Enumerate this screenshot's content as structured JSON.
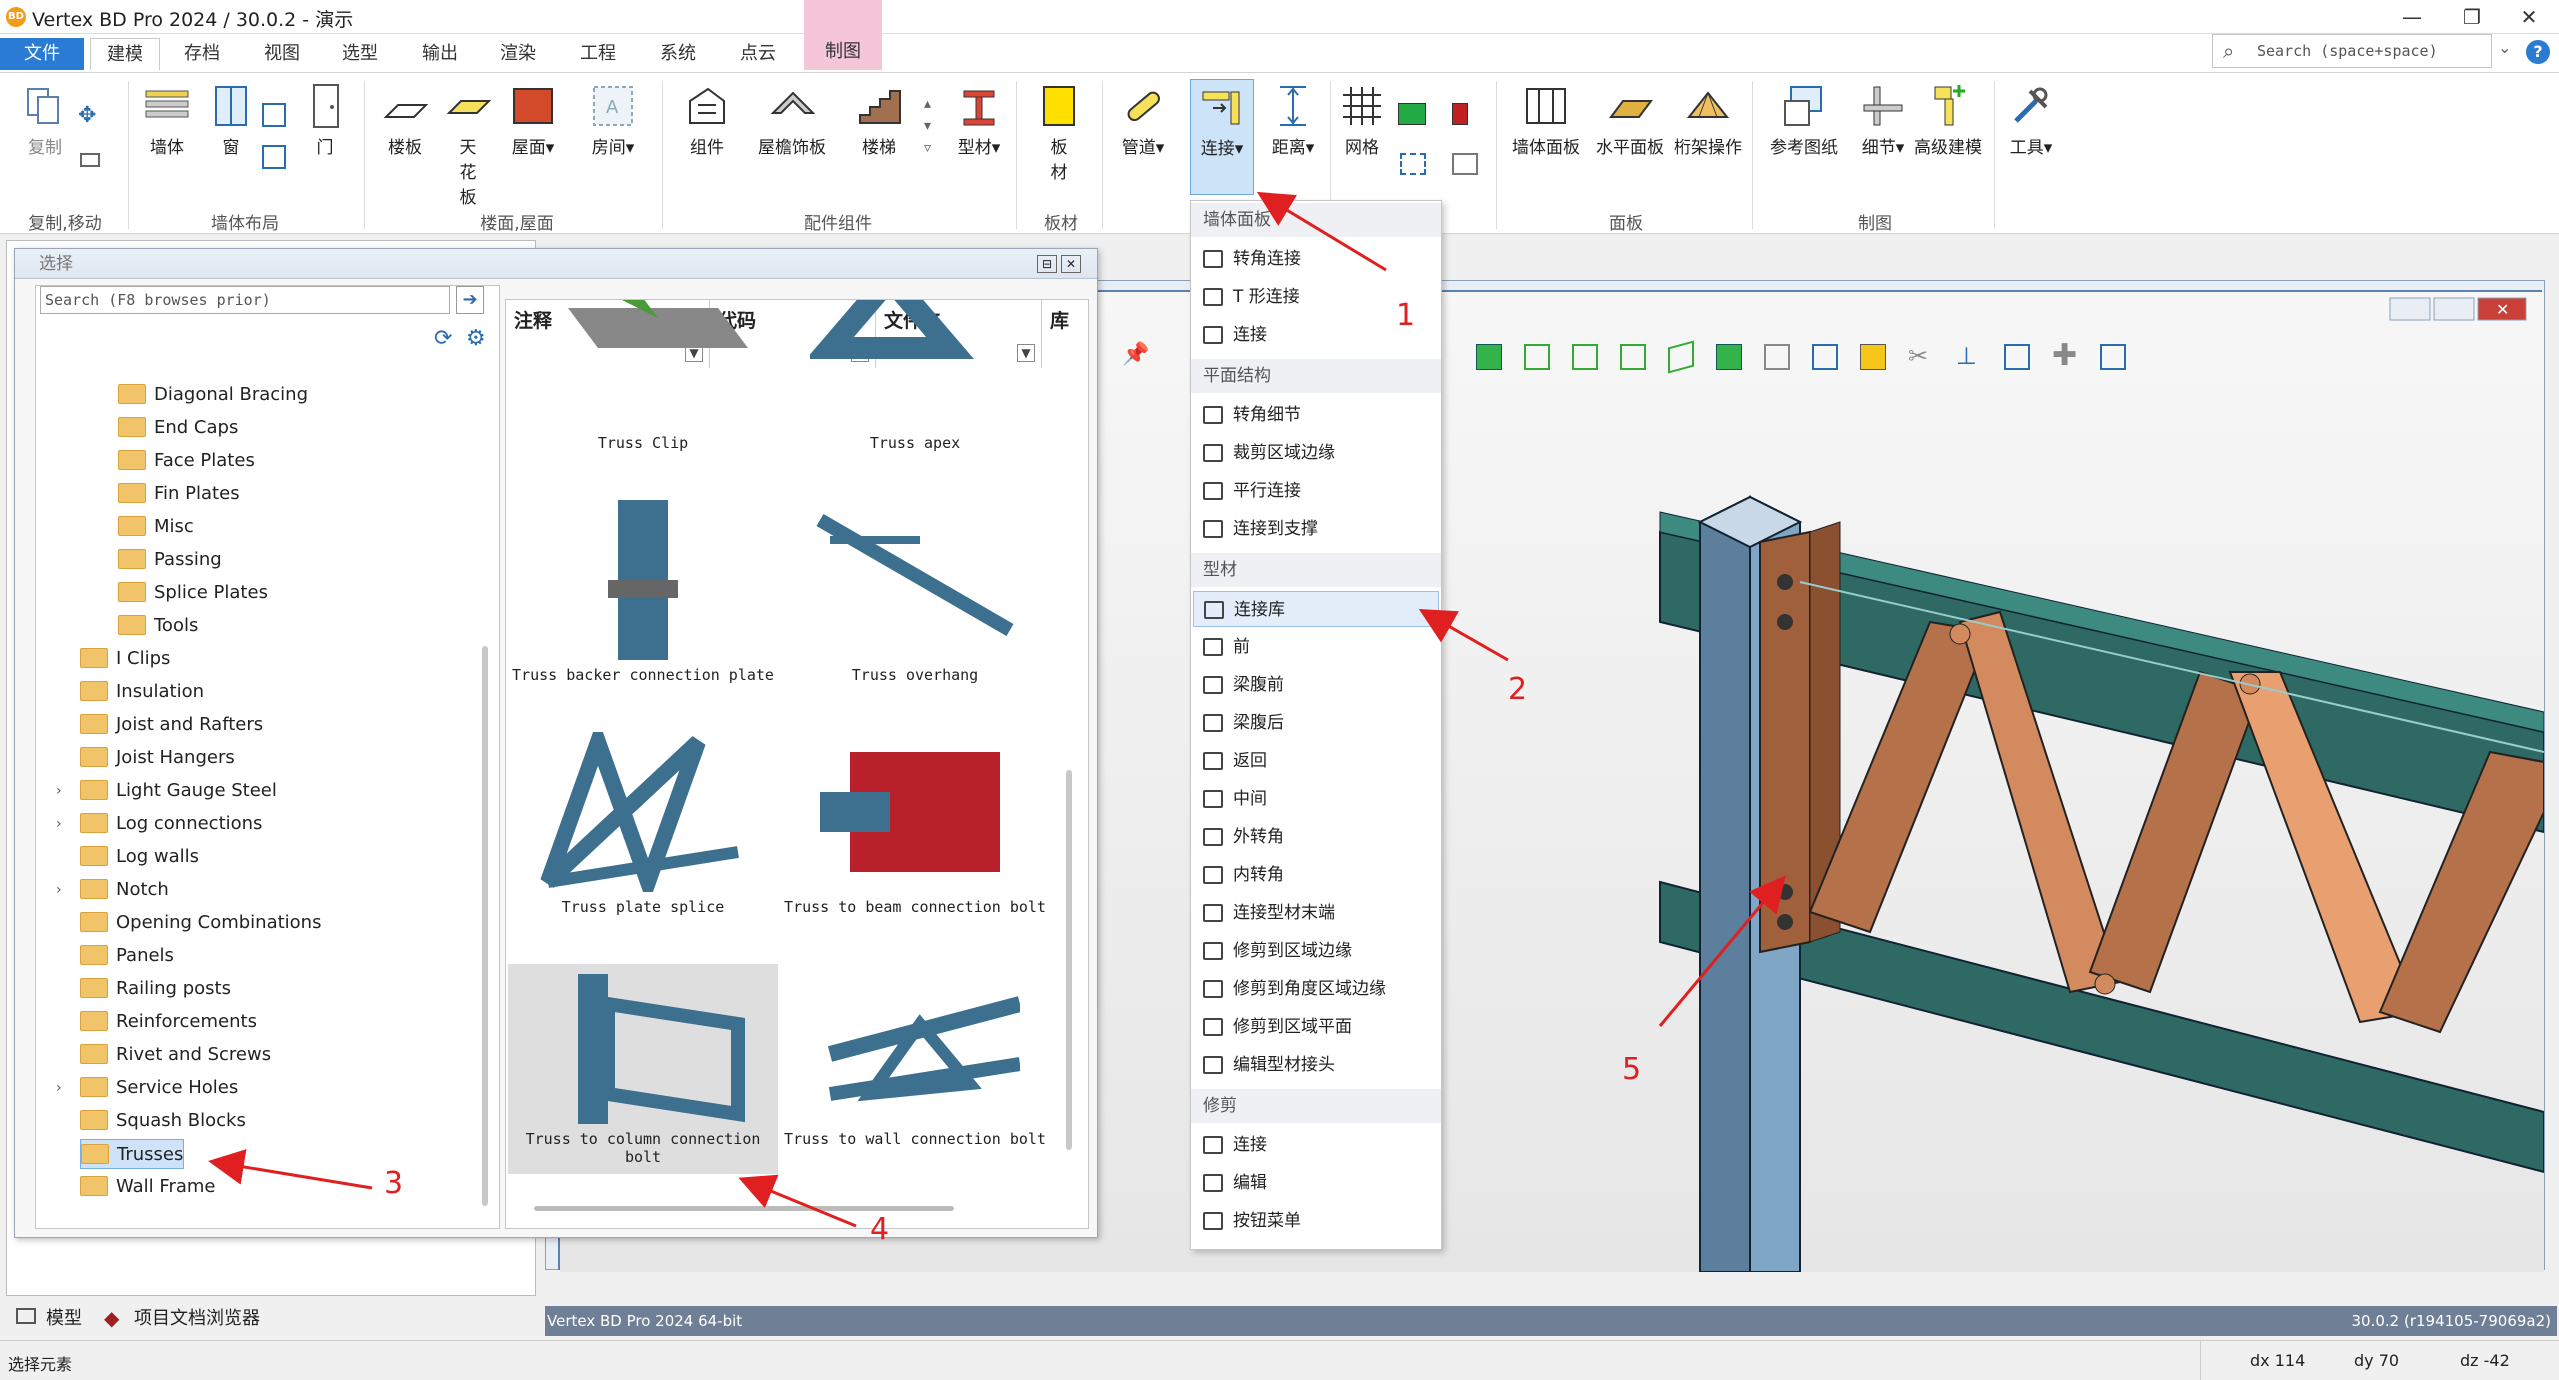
{
  "app": {
    "title": "Vertex BD Pro 2024 / 30.0.2 - 演示",
    "logo": "BD"
  },
  "window_controls": {
    "minimize": "—",
    "maximize": "❐",
    "close": "✕"
  },
  "tabs": [
    {
      "label": "文件"
    },
    {
      "label": "建模"
    },
    {
      "label": "存档"
    },
    {
      "label": "视图"
    },
    {
      "label": "选型"
    },
    {
      "label": "输出"
    },
    {
      "label": "渲染"
    },
    {
      "label": "工程"
    },
    {
      "label": "系统"
    },
    {
      "label": "点云"
    },
    {
      "label": "制图"
    }
  ],
  "search": {
    "placeholder": "Search (space+space)"
  },
  "ribbon": {
    "buttons": {
      "copy": "复制",
      "wall": "墙体",
      "window": "窗",
      "door": "门",
      "floor": "楼板",
      "ceiling": "天花板",
      "roof": "屋面",
      "room": "房间",
      "component": "组件",
      "eaves": "屋檐饰板",
      "stairs": "楼梯",
      "profile": "型材",
      "board": "板材",
      "pipe": "管道",
      "connect": "连接",
      "distance": "距离",
      "grid": "网格",
      "wall_panel": "墙体面板",
      "floor_panel": "水平面板",
      "truss_op": "桁架操作",
      "ref_drawing": "参考图纸",
      "detail": "细节",
      "adv_model": "高级建模",
      "tools": "工具"
    },
    "groups": {
      "copy_move": "复制,移动",
      "wall_layout": "墙体布局",
      "floor_roof": "楼面,屋面",
      "components": "配件组件",
      "board": "板材",
      "panel": "面板",
      "drafting": "制图"
    }
  },
  "select_panel": {
    "title": "选择",
    "search_placeholder": "Search (F8 browses prior)",
    "tree": [
      {
        "label": "Diagonal Bracing",
        "level": 2
      },
      {
        "label": "End Caps",
        "level": 2
      },
      {
        "label": "Face Plates",
        "level": 2
      },
      {
        "label": "Fin Plates",
        "level": 2
      },
      {
        "label": "Misc",
        "level": 2
      },
      {
        "label": "Passing",
        "level": 2
      },
      {
        "label": "Splice Plates",
        "level": 2
      },
      {
        "label": "Tools",
        "level": 2
      },
      {
        "label": "I Clips",
        "level": 1
      },
      {
        "label": "Insulation",
        "level": 1
      },
      {
        "label": "Joist and Rafters",
        "level": 1
      },
      {
        "label": "Joist Hangers",
        "level": 1
      },
      {
        "label": "Light Gauge Steel",
        "level": 1,
        "expand": "›"
      },
      {
        "label": "Log connections",
        "level": 1,
        "expand": "›"
      },
      {
        "label": "Log walls",
        "level": 1
      },
      {
        "label": "Notch",
        "level": 1,
        "expand": "›"
      },
      {
        "label": "Opening Combinations",
        "level": 1
      },
      {
        "label": "Panels",
        "level": 1
      },
      {
        "label": "Railing posts",
        "level": 1
      },
      {
        "label": "Reinforcements",
        "level": 1
      },
      {
        "label": "Rivet and Screws",
        "level": 1
      },
      {
        "label": "Service Holes",
        "level": 1,
        "expand": "›"
      },
      {
        "label": "Squash Blocks",
        "level": 1
      },
      {
        "label": "Trusses",
        "level": 1,
        "selected": true
      },
      {
        "label": "Wall Frame",
        "level": 1
      }
    ],
    "columns": [
      "注释",
      "代码",
      "文件夹",
      "库"
    ],
    "thumbs": [
      {
        "caption": "Truss Clip"
      },
      {
        "caption": "Truss apex"
      },
      {
        "caption": "Truss backer connection plate"
      },
      {
        "caption": "Truss overhang"
      },
      {
        "caption": "Truss plate splice"
      },
      {
        "caption": "Truss to beam connection bolt"
      },
      {
        "caption": "Truss to column connection bolt",
        "highlighted": true
      },
      {
        "caption": "Truss to wall connection bolt"
      }
    ]
  },
  "menu": {
    "sections": [
      {
        "title": "墙体面板",
        "items": [
          "转角连接",
          "T 形连接",
          "连接"
        ]
      },
      {
        "title": "平面结构",
        "items": [
          "转角细节",
          "裁剪区域边缘",
          "平行连接",
          "连接到支撑"
        ]
      },
      {
        "title": "型材",
        "items": [
          "连接库",
          "前",
          "梁腹前",
          "梁腹后",
          "返回",
          "中间",
          "外转角",
          "内转角",
          "连接型材末端",
          "修剪到区域边缘",
          "修剪到角度区域边缘",
          "修剪到区域平面",
          "编辑型材接头"
        ]
      },
      {
        "title": "修剪",
        "items": [
          "连接",
          "编辑",
          "按钮菜单"
        ]
      }
    ],
    "highlighted_item": "连接库"
  },
  "annotations": [
    "1",
    "2",
    "3",
    "4",
    "5"
  ],
  "bottom": {
    "tab_model": "模型",
    "tab_browser": "项目文档浏览器",
    "status_left": "选择元素",
    "viewport_label": "Vertex BD Pro 2024 64-bit",
    "version": "30.0.2 (r194105-79069a2)",
    "dx": "dx 114",
    "dy": "dy 70",
    "dz": "dz -42"
  },
  "colors": {
    "accent": "#2a7bd4",
    "annotation": "#e02020",
    "steel": "#3d6f8f",
    "timber": "#b5714a"
  }
}
